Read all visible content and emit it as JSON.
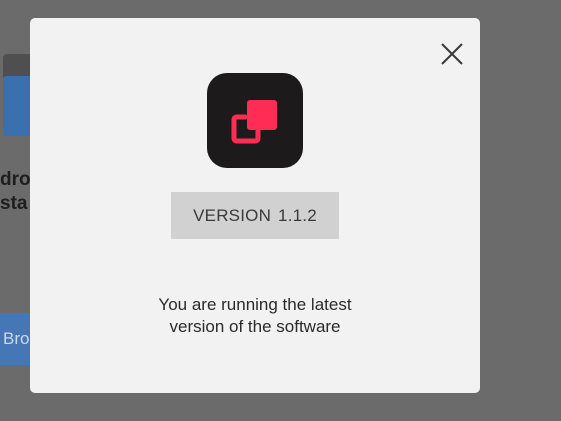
{
  "background": {
    "title_fragment_line1": "dro",
    "title_fragment_line2": "sta",
    "button_fragment": "Bro"
  },
  "modal": {
    "close_icon": "close-x-icon",
    "app_icon": "overlapping-squares-icon",
    "app_icon_bg_color": "#1c1a1b",
    "app_icon_accent_color": "#ff2d55",
    "version_label": "VERSION",
    "version_number": "1.1.2",
    "message_line1": "You are running the latest",
    "message_line2": "version of the software"
  },
  "colors": {
    "backdrop": "#6b6b6b",
    "modal_bg": "#f2f2f2",
    "badge_bg": "#d1d1d1",
    "background_button": "#4576b5"
  }
}
